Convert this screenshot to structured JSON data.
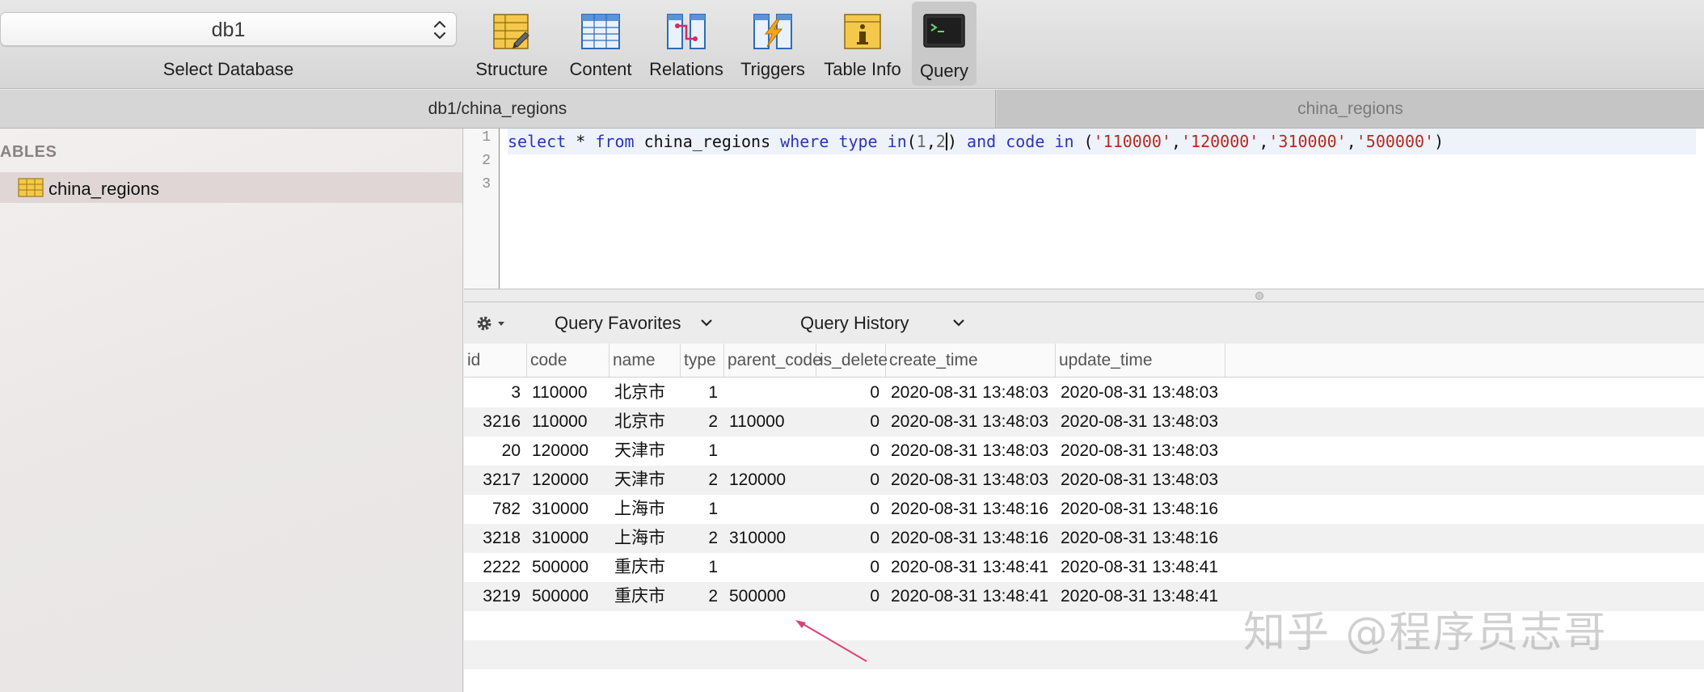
{
  "toolbar": {
    "database": {
      "value": "db1",
      "label": "Select Database"
    },
    "buttons": [
      {
        "label": "Structure",
        "icon": "structure-icon"
      },
      {
        "label": "Content",
        "icon": "content-icon"
      },
      {
        "label": "Relations",
        "icon": "relations-icon"
      },
      {
        "label": "Triggers",
        "icon": "triggers-icon"
      },
      {
        "label": "Table Info",
        "icon": "table-info-icon"
      },
      {
        "label": "Query",
        "icon": "terminal-icon",
        "active": true
      }
    ]
  },
  "tabs": [
    {
      "label": "db1/china_regions",
      "active": true
    },
    {
      "label": "china_regions",
      "active": false
    }
  ],
  "sidebar": {
    "header": "ABLES",
    "items": [
      {
        "label": "china_regions",
        "icon": "table-icon",
        "selected": true
      }
    ]
  },
  "editor": {
    "line_numbers": [
      "1",
      "2",
      "3"
    ],
    "tokens": [
      {
        "text": "select",
        "kind": "kw"
      },
      {
        "text": " * ",
        "kind": "plain"
      },
      {
        "text": "from",
        "kind": "kw"
      },
      {
        "text": " china_regions ",
        "kind": "plain"
      },
      {
        "text": "where",
        "kind": "kw"
      },
      {
        "text": " ",
        "kind": "plain"
      },
      {
        "text": "type",
        "kind": "kw"
      },
      {
        "text": " ",
        "kind": "plain"
      },
      {
        "text": "in",
        "kind": "kw"
      },
      {
        "text": "(",
        "kind": "plain"
      },
      {
        "text": "1",
        "kind": "num"
      },
      {
        "text": ",",
        "kind": "plain"
      },
      {
        "text": "2",
        "kind": "num"
      },
      {
        "text": "|caret|",
        "kind": "caret"
      },
      {
        "text": ") ",
        "kind": "plain"
      },
      {
        "text": "and",
        "kind": "kw"
      },
      {
        "text": " ",
        "kind": "plain"
      },
      {
        "text": "code",
        "kind": "kw"
      },
      {
        "text": " ",
        "kind": "plain"
      },
      {
        "text": "in",
        "kind": "kw"
      },
      {
        "text": " (",
        "kind": "plain"
      },
      {
        "text": "'110000'",
        "kind": "str"
      },
      {
        "text": ",",
        "kind": "plain"
      },
      {
        "text": "'120000'",
        "kind": "str"
      },
      {
        "text": ",",
        "kind": "plain"
      },
      {
        "text": "'310000'",
        "kind": "str"
      },
      {
        "text": ",",
        "kind": "plain"
      },
      {
        "text": "'500000'",
        "kind": "str"
      },
      {
        "text": ")",
        "kind": "plain"
      }
    ]
  },
  "query_bar": {
    "favorites_label": "Query Favorites",
    "history_label": "Query History"
  },
  "results": {
    "columns": [
      "id",
      "code",
      "name",
      "type",
      "parent_code",
      "is_delete",
      "create_time",
      "update_time"
    ],
    "rows": [
      [
        "3",
        "110000",
        "北京市",
        "1",
        "",
        "0",
        "2020-08-31 13:48:03",
        "2020-08-31 13:48:03"
      ],
      [
        "3216",
        "110000",
        "北京市",
        "2",
        "110000",
        "0",
        "2020-08-31 13:48:03",
        "2020-08-31 13:48:03"
      ],
      [
        "20",
        "120000",
        "天津市",
        "1",
        "",
        "0",
        "2020-08-31 13:48:03",
        "2020-08-31 13:48:03"
      ],
      [
        "3217",
        "120000",
        "天津市",
        "2",
        "120000",
        "0",
        "2020-08-31 13:48:03",
        "2020-08-31 13:48:03"
      ],
      [
        "782",
        "310000",
        "上海市",
        "1",
        "",
        "0",
        "2020-08-31 13:48:16",
        "2020-08-31 13:48:16"
      ],
      [
        "3218",
        "310000",
        "上海市",
        "2",
        "310000",
        "0",
        "2020-08-31 13:48:16",
        "2020-08-31 13:48:16"
      ],
      [
        "2222",
        "500000",
        "重庆市",
        "1",
        "",
        "0",
        "2020-08-31 13:48:41",
        "2020-08-31 13:48:41"
      ],
      [
        "3219",
        "500000",
        "重庆市",
        "2",
        "500000",
        "0",
        "2020-08-31 13:48:41",
        "2020-08-31 13:48:41"
      ]
    ]
  },
  "watermark": "知乎 @程序员志哥",
  "colors": {
    "keyword": "#2d35b8",
    "string": "#b62a1d",
    "arrow": "#e0407a"
  }
}
